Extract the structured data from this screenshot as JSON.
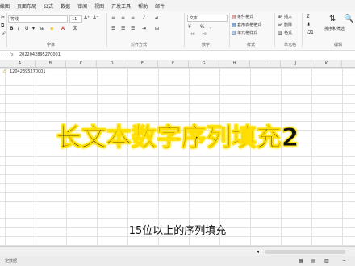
{
  "menu": [
    "绘图",
    "页面布局",
    "公式",
    "数据",
    "审阅",
    "视图",
    "开发工具",
    "帮助",
    "邮件"
  ],
  "ribbon": {
    "font_name": "等线",
    "font_size": "11",
    "bold": "B",
    "italic": "I",
    "underline": "U",
    "font_group_label": "字体",
    "align_group_label": "对齐方式",
    "number_format": "文本",
    "percent": "%",
    "thousands": ",",
    "number_group_label": "数字",
    "cond_format": "条件格式",
    "table_format": "套用表格格式",
    "cell_style": "单元格样式",
    "style_group_label": "样式",
    "insert": "插入",
    "delete": "删除",
    "format": "格式",
    "cells_group_label": "单元格",
    "sort_filter": "排序和筛选",
    "editing_group_label": "编辑"
  },
  "formula_bar": {
    "fx": "fx",
    "content": "202204289527000​1"
  },
  "columns": [
    "A",
    "B",
    "C",
    "D",
    "E",
    "F",
    "G",
    "H",
    "I",
    "J",
    "K"
  ],
  "cell_a1": "12042895270001",
  "overlay": {
    "title": "长文本数字序列填充2",
    "subtitle": "15位以上的序列填充"
  },
  "status": "一定数据"
}
